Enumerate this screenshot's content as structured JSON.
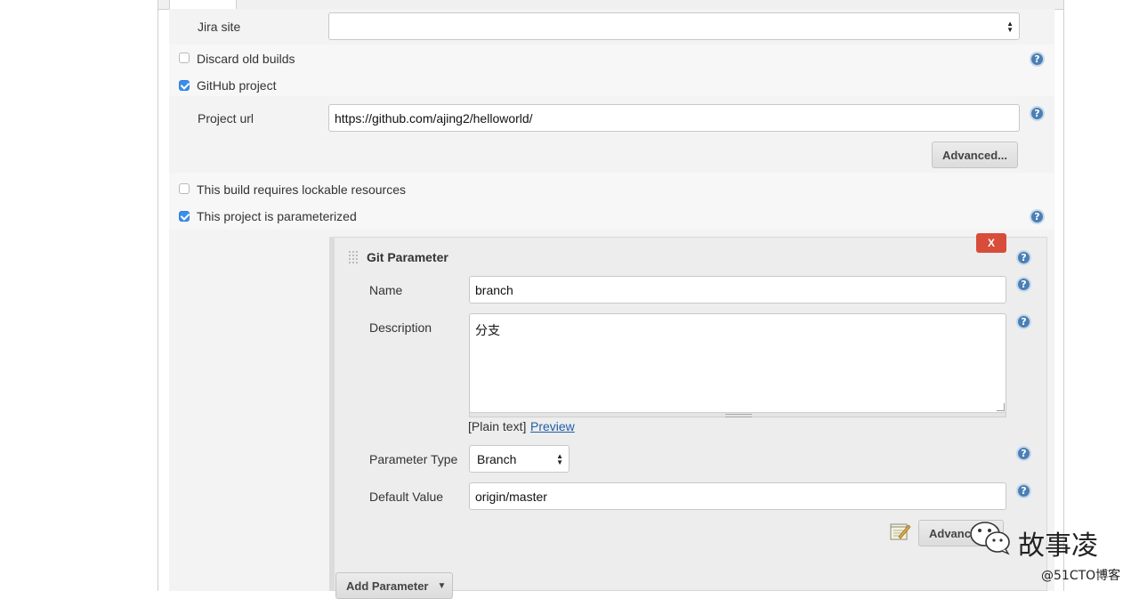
{
  "form": {
    "jira_site_label": "Jira site",
    "jira_site_value": "",
    "discard_old_builds_label": "Discard old builds",
    "github_project_label": "GitHub project",
    "project_url_label": "Project url",
    "project_url_value": "https://github.com/ajing2/helloworld/",
    "advanced_label": "Advanced...",
    "lockable_label": "This build requires lockable resources",
    "parameterized_label": "This project is parameterized"
  },
  "git_parameter": {
    "delete_label": "X",
    "title": "Git Parameter",
    "name_label": "Name",
    "name_value": "branch",
    "description_label": "Description",
    "description_value": "分支",
    "plain_text_label": "[Plain text]",
    "preview_label": "Preview",
    "parameter_type_label": "Parameter Type",
    "parameter_type_value": "Branch",
    "default_value_label": "Default Value",
    "default_value_value": "origin/master",
    "advanced_label": "Advanced..."
  },
  "add_parameter_label": "Add Parameter",
  "watermark": {
    "brand": "故事凌",
    "site": "@51CTO博客"
  },
  "colors": {
    "checkbox_checked": "#3b8eea",
    "help_icon": "#4a7fb5",
    "delete_button": "#d84c3a",
    "link": "#1f5ea8"
  }
}
